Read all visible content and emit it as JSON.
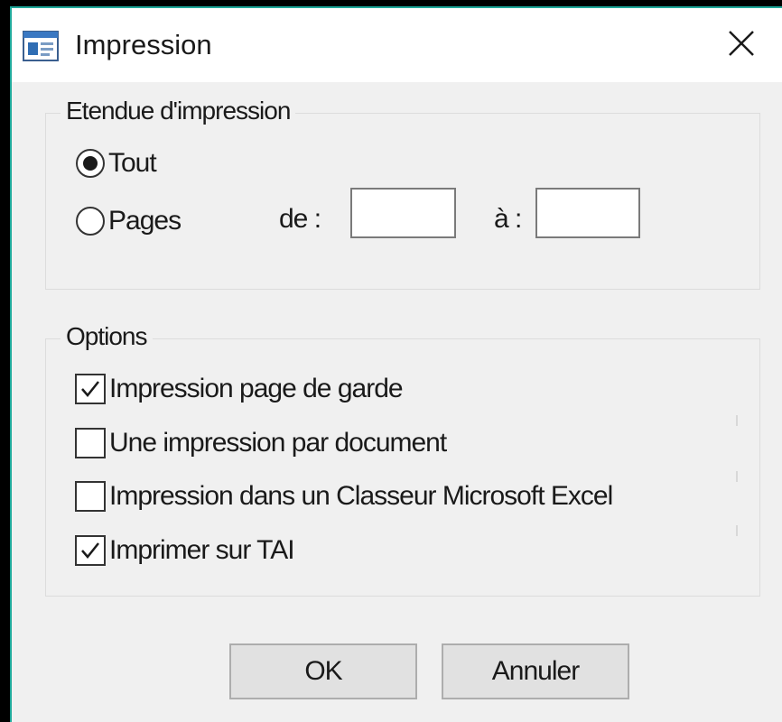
{
  "window": {
    "title": "Impression",
    "close_glyph": "✕",
    "icon": "window-app-icon"
  },
  "range_group": {
    "legend": "Etendue d'impression",
    "options": [
      {
        "label": "Tout",
        "checked": true
      },
      {
        "label": "Pages",
        "checked": false
      }
    ],
    "from_label": "de :",
    "to_label": "à :",
    "from_value": "",
    "to_value": ""
  },
  "options_group": {
    "legend": "Options",
    "items": [
      {
        "label": "Impression page de garde",
        "checked": true
      },
      {
        "label": "Une impression par document",
        "checked": false
      },
      {
        "label": "Impression dans un Classeur Microsoft Excel",
        "checked": false
      },
      {
        "label": "Imprimer sur TAI",
        "checked": true
      }
    ]
  },
  "buttons": {
    "ok": "OK",
    "cancel": "Annuler"
  },
  "colors": {
    "accent_border": "#1fa89a",
    "dialog_bg": "#f0f0f0",
    "titlebar_bg": "#ffffff"
  }
}
